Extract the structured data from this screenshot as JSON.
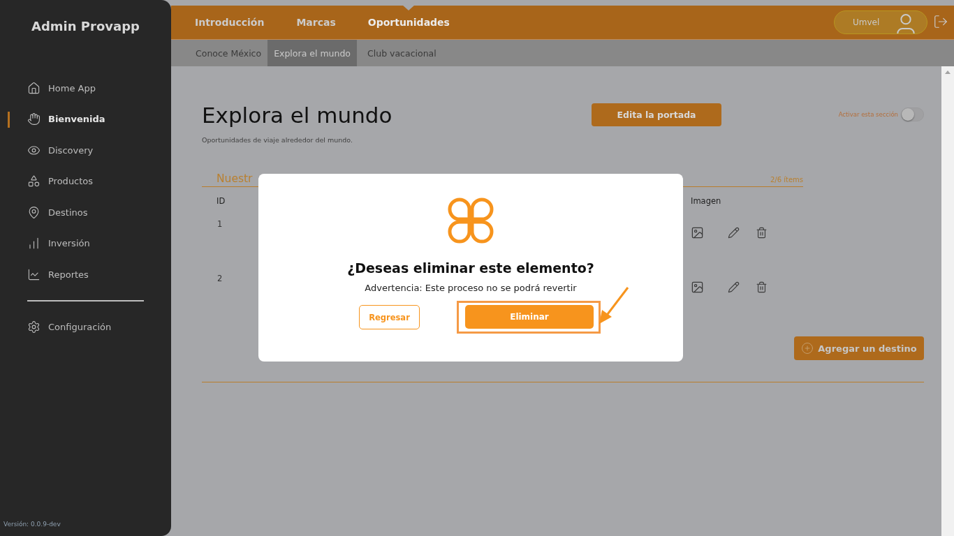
{
  "sidebar": {
    "title": "Admin Provapp",
    "items": [
      {
        "label": "Home App",
        "selected": false
      },
      {
        "label": "Bienvenida",
        "selected": true
      },
      {
        "label": "Discovery",
        "selected": false
      },
      {
        "label": "Productos",
        "selected": false
      },
      {
        "label": "Destinos",
        "selected": false
      },
      {
        "label": "Inversión",
        "selected": false
      },
      {
        "label": "Reportes",
        "selected": false
      }
    ],
    "settings": {
      "label": "Configuración"
    },
    "version": "Versión: 0.0.9-dev"
  },
  "top_nav": {
    "tabs": [
      {
        "label": "Introducción",
        "selected": false
      },
      {
        "label": "Marcas",
        "selected": false
      },
      {
        "label": "Oportunidades",
        "selected": true
      }
    ],
    "user": {
      "name": "Umvel"
    }
  },
  "sub_nav": [
    {
      "label": "Conoce México",
      "selected": false
    },
    {
      "label": "Explora el mundo",
      "selected": true
    },
    {
      "label": "Club vacacional",
      "selected": false
    }
  ],
  "page": {
    "title": "Explora el mundo",
    "subtitle": "Oportunidades de viaje alrededor del mundo.",
    "edit_button": "Edita la portada",
    "toggle": {
      "label": "Activar esta sección",
      "on": false
    }
  },
  "section": {
    "title": "Nuestr",
    "count": "2/6 ítems"
  },
  "table": {
    "columns": [
      "ID",
      "Imagen"
    ],
    "rows": [
      {
        "id": "1"
      },
      {
        "id": "2"
      }
    ]
  },
  "add_button": "Agregar un destino",
  "dialog": {
    "title": "¿Deseas eliminar este elemento?",
    "message": "Advertencia: Este proceso no se podrá revertir",
    "cancel": "Regresar",
    "confirm": "Eliminar",
    "confirm_highlighted": true
  }
}
